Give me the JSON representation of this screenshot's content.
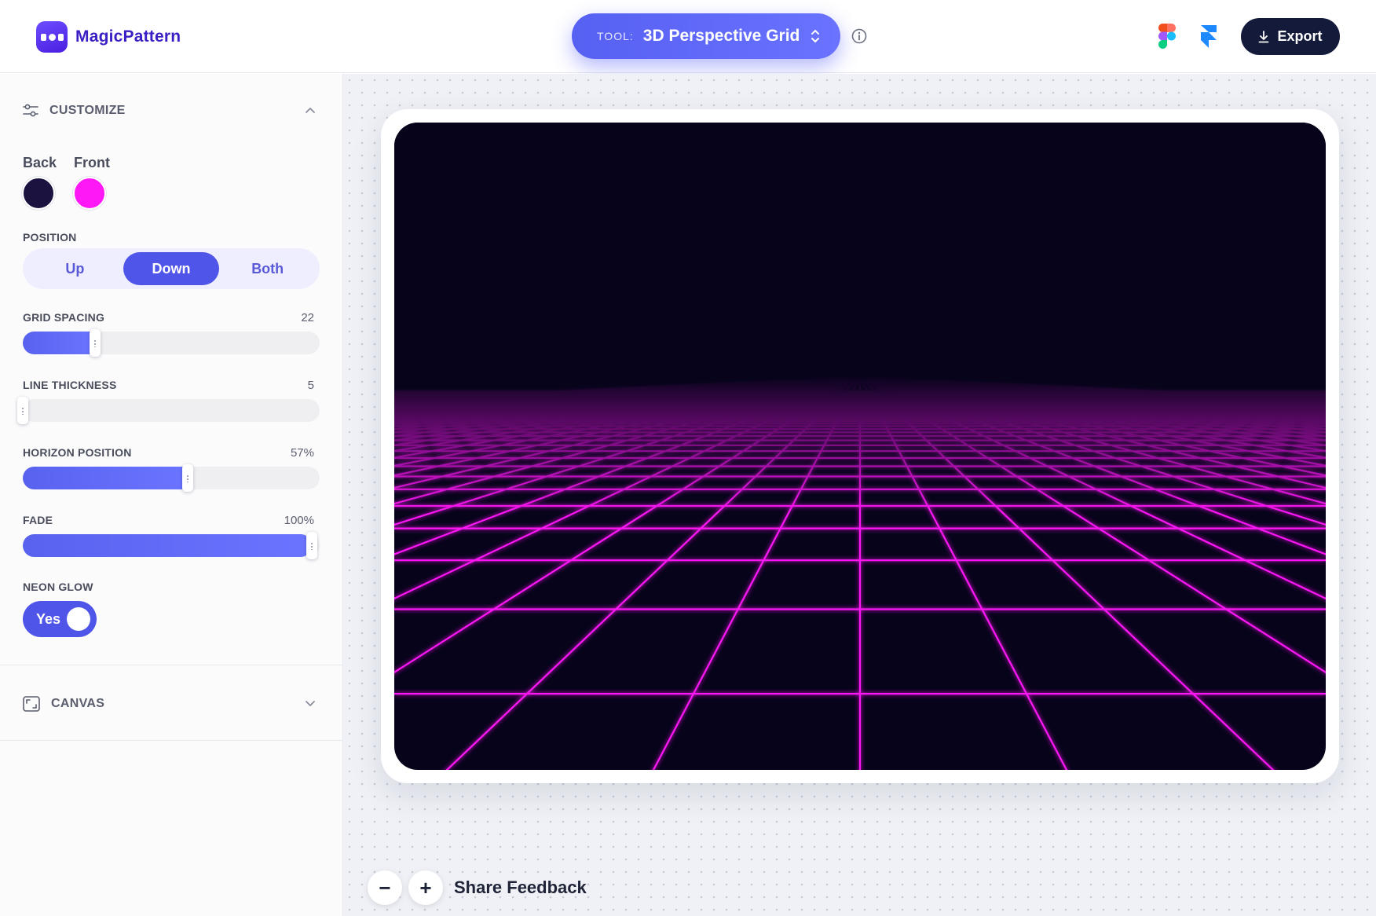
{
  "app": {
    "name": "MagicPattern"
  },
  "toolbar": {
    "tool_label": "TOOL:",
    "tool_name": "3D Perspective Grid",
    "export_label": "Export"
  },
  "customize": {
    "title": "CUSTOMIZE",
    "colors": {
      "back_label": "Back",
      "back_color": "#1c1240",
      "front_label": "Front",
      "front_color": "#ff18f6"
    },
    "position": {
      "label": "POSITION",
      "options": [
        "Up",
        "Down",
        "Both"
      ],
      "selected": "Down"
    },
    "grid_spacing": {
      "label": "GRID SPACING",
      "value": "22",
      "fraction": 0.25
    },
    "line_thickness": {
      "label": "LINE THICKNESS",
      "value": "5",
      "fraction": 0.0
    },
    "horizon_position": {
      "label": "HORIZON POSITION",
      "value": "57%",
      "fraction": 0.57
    },
    "fade": {
      "label": "FADE",
      "value": "100%",
      "fraction": 1.0
    },
    "neon_glow": {
      "label": "NEON GLOW",
      "value": "Yes"
    }
  },
  "canvas_section": {
    "title": "CANVAS"
  },
  "preview": {
    "background": "#06031a",
    "line_color": "#ff18f6"
  },
  "footer": {
    "zoom_out": "−",
    "zoom_in": "+",
    "share_feedback": "Share Feedback"
  }
}
